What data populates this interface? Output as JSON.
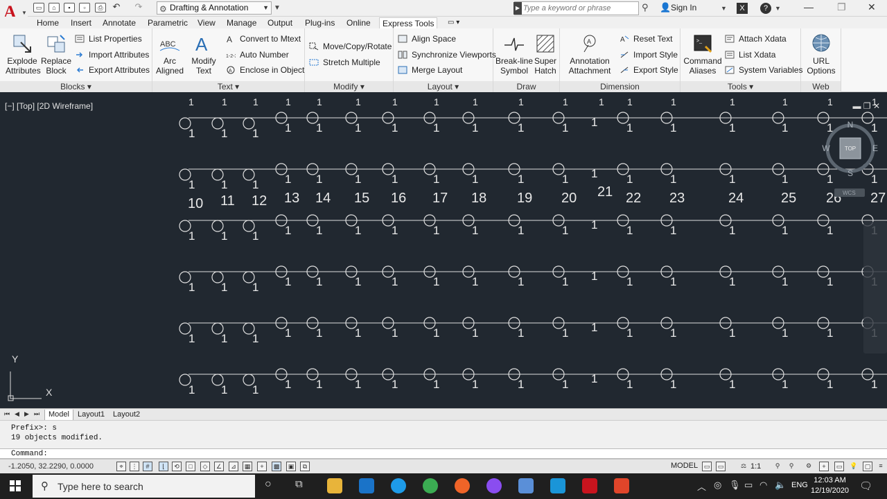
{
  "app": {
    "workspace": "Drafting & Annotation",
    "search_placeholder": "Type a keyword or phrase",
    "sign_in": "Sign In"
  },
  "tabs": [
    "Home",
    "Insert",
    "Annotate",
    "Parametric",
    "View",
    "Manage",
    "Output",
    "Plug-ins",
    "Online",
    "Express Tools"
  ],
  "active_tab": "Express Tools",
  "ribbon": {
    "blocks": {
      "title": "Blocks",
      "explode": [
        "Explode",
        "Attributes"
      ],
      "replace": [
        "Replace",
        "Block"
      ],
      "list_props": "List Properties",
      "import_attr": "Import Attributes",
      "export_attr": "Export Attributes"
    },
    "text": {
      "title": "Text",
      "arc": [
        "Arc",
        "Aligned"
      ],
      "modify": [
        "Modify",
        "Text"
      ],
      "convert": "Convert to Mtext",
      "auto_num": "Auto Number",
      "enclose": "Enclose in Object"
    },
    "modify": {
      "title": "Modify",
      "move": "Move/Copy/Rotate",
      "stretch": "Stretch Multiple"
    },
    "layout": {
      "title": "Layout",
      "align": "Align Space",
      "sync": "Synchronize Viewports",
      "merge": "Merge Layout"
    },
    "draw": {
      "title": "Draw",
      "breakline": [
        "Break-line",
        "Symbol"
      ],
      "superhatch": [
        "Super",
        "Hatch"
      ]
    },
    "dimension": {
      "title": "Dimension",
      "annot": [
        "Annotation",
        "Attachment"
      ],
      "reset": "Reset Text",
      "import": "Import Style",
      "export": "Export Style"
    },
    "tools": {
      "title": "Tools",
      "cmd": [
        "Command",
        "Aliases"
      ],
      "attach": "Attach Xdata",
      "list": "List Xdata",
      "sysvar": "System Variables"
    },
    "web": {
      "title": "Web",
      "url": [
        "URL",
        "Options"
      ]
    }
  },
  "viewport": {
    "label": "[−] [Top] [2D Wireframe]",
    "ucs_x": "X",
    "ucs_y": "Y",
    "viewcube": {
      "top": "TOP",
      "n": "N",
      "s": "S",
      "e": "E",
      "w": "W",
      "wcs": "WCS"
    }
  },
  "drawing": {
    "row_label": "1",
    "numbers": [
      "10",
      "11",
      "12",
      "13",
      "14",
      "15",
      "16",
      "17",
      "18",
      "19",
      "20",
      "21",
      "22",
      "23",
      "24",
      "25",
      "26",
      "27"
    ]
  },
  "layout_tabs": [
    "Model",
    "Layout1",
    "Layout2"
  ],
  "command": {
    "history": [
      "Prefix>: s",
      "19 objects modified."
    ],
    "prompt": "Command:"
  },
  "status": {
    "coords": "-1.2050, 32.2290, 0.0000",
    "model": "MODEL",
    "scale": "1:1"
  },
  "taskbar": {
    "search": "Type here to search",
    "lang": "ENG",
    "time": "12:03 AM",
    "date": "12/19/2020"
  }
}
